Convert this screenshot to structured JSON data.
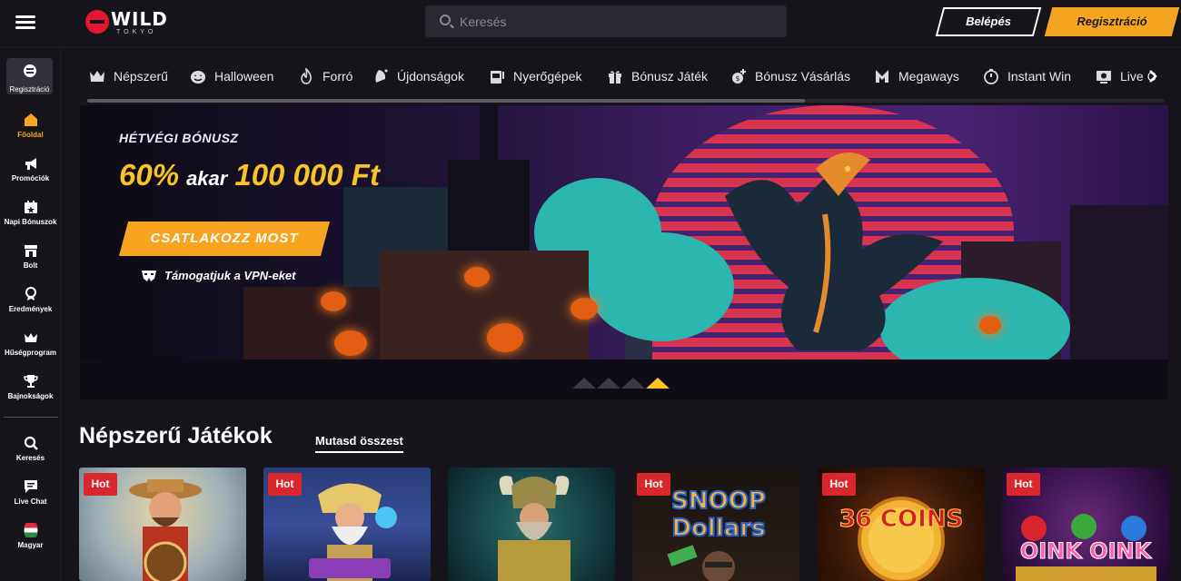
{
  "header": {
    "logo_main": "WILD",
    "logo_sub": "TOKYO",
    "search_placeholder": "Keresés",
    "login_label": "Belépés",
    "register_label": "Regisztráció"
  },
  "sidebar": {
    "register_label": "Regisztráció",
    "items": [
      {
        "label": "Főoldal",
        "icon": "home-icon",
        "active": true
      },
      {
        "label": "Promóciók",
        "icon": "megaphone-icon"
      },
      {
        "label": "Napi Bónuszok",
        "icon": "calendar-star-icon"
      },
      {
        "label": "Bolt",
        "icon": "shop-icon"
      },
      {
        "label": "Eredmények",
        "icon": "medal-icon"
      },
      {
        "label": "Hűségprogram",
        "icon": "crown-icon"
      },
      {
        "label": "Bajnokságok",
        "icon": "trophy-icon"
      }
    ],
    "bottom_items": [
      {
        "label": "Keresés",
        "icon": "search-icon"
      },
      {
        "label": "Live Chat",
        "icon": "chat-icon"
      },
      {
        "label": "Magyar",
        "icon": "hungary-flag-icon"
      }
    ]
  },
  "categories": [
    {
      "label": "Népszerű",
      "icon": "crown-icon"
    },
    {
      "label": "Halloween",
      "icon": "pumpkin-icon"
    },
    {
      "label": "Forró",
      "icon": "flame-icon"
    },
    {
      "label": "Újdonságok",
      "icon": "sparkle-icon"
    },
    {
      "label": "Nyerőgépek",
      "icon": "slot-machine-icon"
    },
    {
      "label": "Bónusz Játék",
      "icon": "gift-icon"
    },
    {
      "label": "Bónusz Vásárlás",
      "icon": "coin-plus-icon"
    },
    {
      "label": "Megaways",
      "icon": "megaways-icon"
    },
    {
      "label": "Instant Win",
      "icon": "stopwatch-icon"
    },
    {
      "label": "Live C",
      "icon": "live-casino-icon"
    }
  ],
  "banner": {
    "label": "HÉTVÉGI BÓNUSZ",
    "percent": "60%",
    "connector": "akar",
    "amount": "100 000 Ft",
    "cta_label": "CSATLAKOZZ MOST",
    "vpn_text": "Támogatjuk a VPN-eket",
    "slides": 4,
    "active_slide": 4,
    "colors": {
      "accent": "#f7c326",
      "cta": "#f7a520"
    }
  },
  "popular": {
    "title": "Népszerű Játékok",
    "show_all": "Mutasd összest",
    "games": [
      {
        "badge": "Hot",
        "name": "",
        "theme": "fisherman"
      },
      {
        "badge": "Hot",
        "name": "",
        "theme": "olympus"
      },
      {
        "badge": "",
        "name": "",
        "theme": "viking"
      },
      {
        "badge": "Hot",
        "name": "",
        "theme": "snoop"
      },
      {
        "badge": "Hot",
        "name": "36 COINS",
        "theme": "coins"
      },
      {
        "badge": "Hot",
        "name": "",
        "theme": "oink"
      }
    ]
  }
}
